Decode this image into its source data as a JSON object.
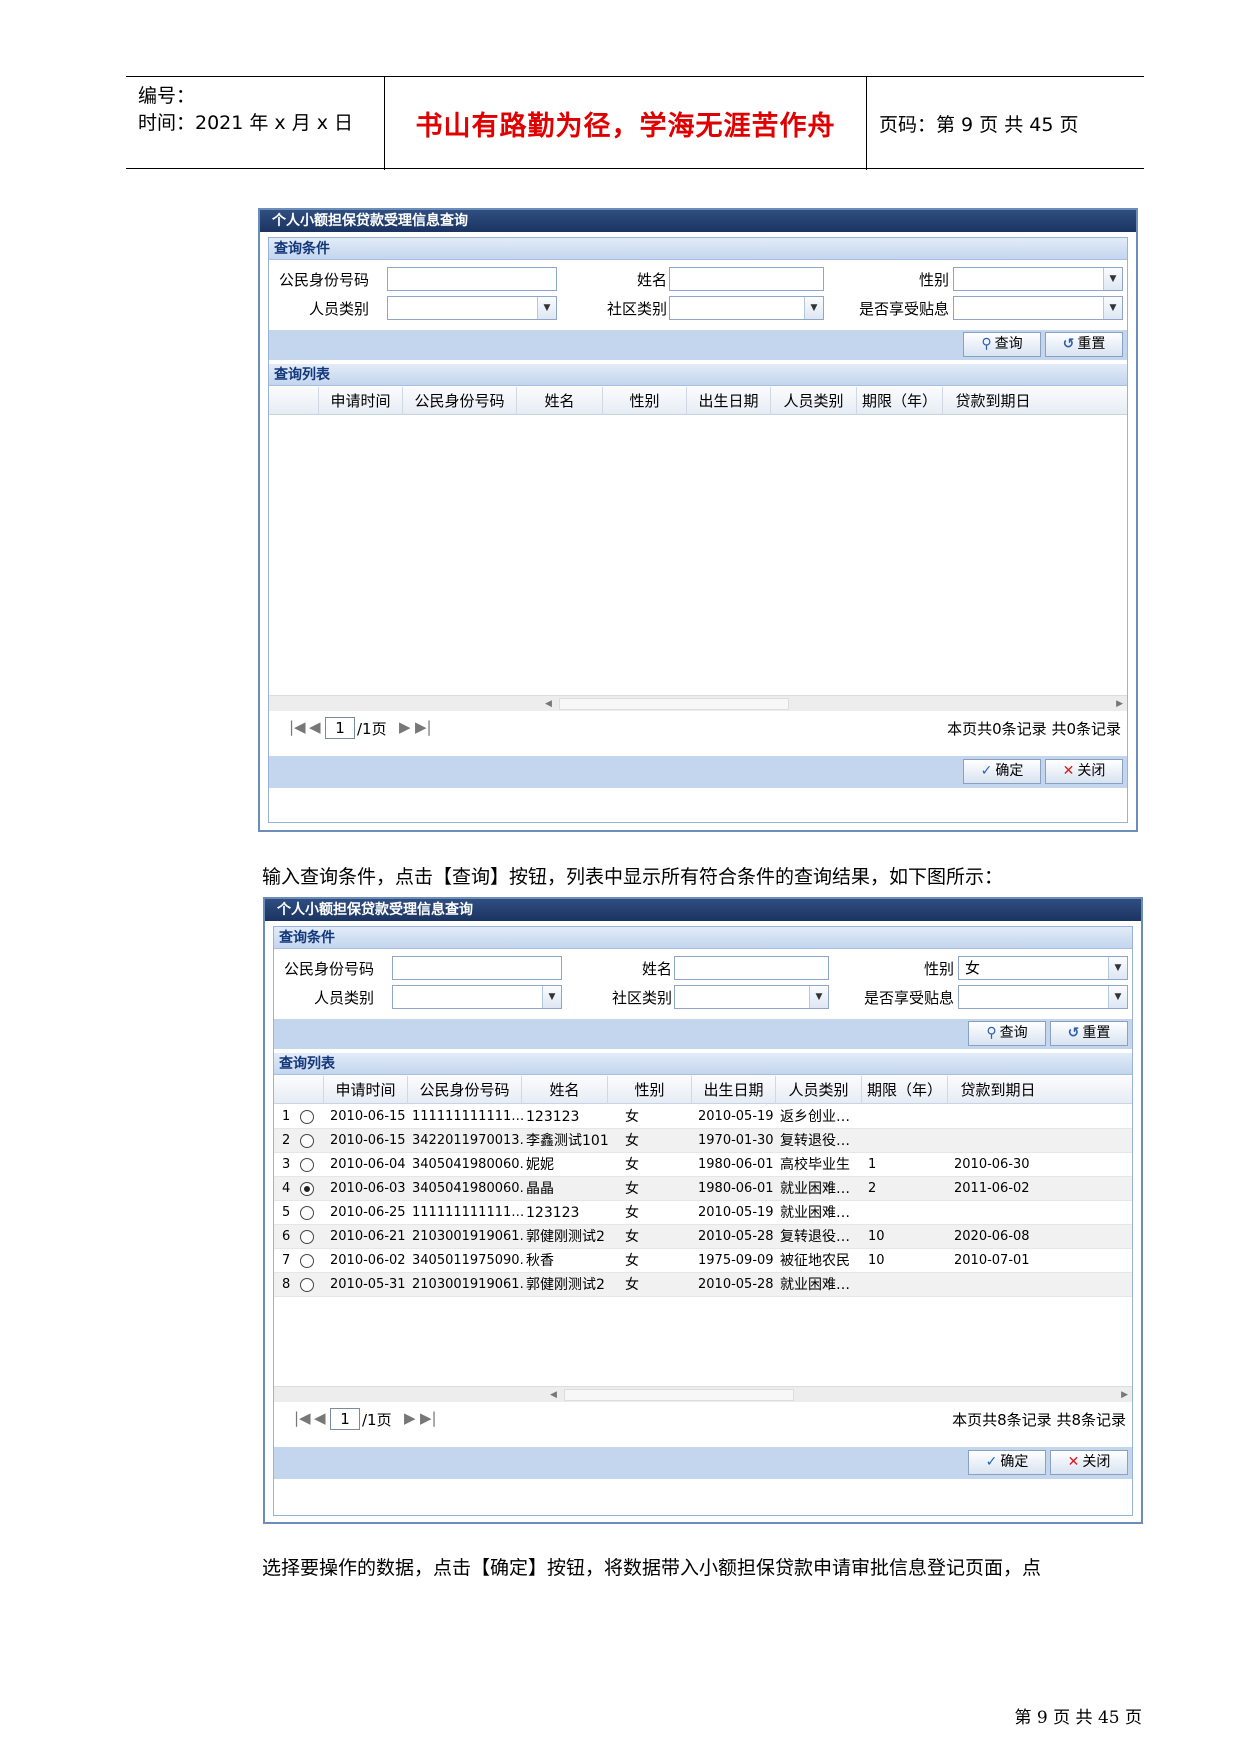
{
  "header": {
    "number_label": "编号：",
    "time_label": "时间：2021 年 x 月 x 日",
    "motto": "书山有路勤为径，学海无涯苦作舟",
    "page_label": "页码：第 9 页  共 45 页"
  },
  "window1": {
    "title": "个人小额担保贷款受理信息查询",
    "conditions_title": "查询条件",
    "labels": {
      "id": "公民身份号码",
      "name": "姓名",
      "gender": "性别",
      "person_type": "人员类别",
      "community": "社区类别",
      "subsidy": "是否享受贴息"
    },
    "values": {
      "id": "",
      "name": "",
      "gender": "",
      "person_type": "",
      "community": "",
      "subsidy": ""
    },
    "query_btn": "查询",
    "reset_btn": "重置",
    "list_title": "查询列表",
    "columns": [
      "申请时间",
      "公民身份号码",
      "姓名",
      "性别",
      "出生日期",
      "人员类别",
      "期限（年）",
      "贷款到期日"
    ],
    "pager": {
      "page": "1",
      "total_pages": "/1页",
      "summary": "本页共0条记录 共0条记录"
    },
    "ok_btn": "确定",
    "close_btn": "关闭"
  },
  "paragraph1": "输入查询条件，点击【查询】按钮，列表中显示所有符合条件的查询结果，如下图所示：",
  "window2": {
    "title": "个人小额担保贷款受理信息查询",
    "conditions_title": "查询条件",
    "labels": {
      "id": "公民身份号码",
      "name": "姓名",
      "gender": "性别",
      "person_type": "人员类别",
      "community": "社区类别",
      "subsidy": "是否享受贴息"
    },
    "values": {
      "id": "",
      "name": "",
      "gender": "女",
      "person_type": "",
      "community": "",
      "subsidy": ""
    },
    "query_btn": "查询",
    "reset_btn": "重置",
    "list_title": "查询列表",
    "columns": [
      "申请时间",
      "公民身份号码",
      "姓名",
      "性别",
      "出生日期",
      "人员类别",
      "期限（年）",
      "贷款到期日"
    ],
    "rows": [
      {
        "n": "1",
        "date": "2010-06-15",
        "id": "111111111111…",
        "name": "123123",
        "gender": "女",
        "birth": "2010-05-19",
        "type": "返乡创业…",
        "term": "",
        "due": "",
        "selected": false
      },
      {
        "n": "2",
        "date": "2010-06-15",
        "id": "3422011970013…",
        "name": "李鑫测试101",
        "gender": "女",
        "birth": "1970-01-30",
        "type": "复转退役…",
        "term": "",
        "due": "",
        "selected": false
      },
      {
        "n": "3",
        "date": "2010-06-04",
        "id": "3405041980060…",
        "name": "妮妮",
        "gender": "女",
        "birth": "1980-06-01",
        "type": "高校毕业生",
        "term": "1",
        "due": "2010-06-30",
        "selected": false
      },
      {
        "n": "4",
        "date": "2010-06-03",
        "id": "3405041980060…",
        "name": "晶晶",
        "gender": "女",
        "birth": "1980-06-01",
        "type": "就业困难…",
        "term": "2",
        "due": "2011-06-02",
        "selected": true
      },
      {
        "n": "5",
        "date": "2010-06-25",
        "id": "111111111111…",
        "name": "123123",
        "gender": "女",
        "birth": "2010-05-19",
        "type": "就业困难…",
        "term": "",
        "due": "",
        "selected": false
      },
      {
        "n": "6",
        "date": "2010-06-21",
        "id": "2103001919061…",
        "name": "郭健刚测试2",
        "gender": "女",
        "birth": "2010-05-28",
        "type": "复转退役…",
        "term": "10",
        "due": "2020-06-08",
        "selected": false
      },
      {
        "n": "7",
        "date": "2010-06-02",
        "id": "3405011975090…",
        "name": "秋香",
        "gender": "女",
        "birth": "1975-09-09",
        "type": "被征地农民",
        "term": "10",
        "due": "2010-07-01",
        "selected": false
      },
      {
        "n": "8",
        "date": "2010-05-31",
        "id": "2103001919061…",
        "name": "郭健刚测试2",
        "gender": "女",
        "birth": "2010-05-28",
        "type": "就业困难…",
        "term": "",
        "due": "",
        "selected": false
      }
    ],
    "pager": {
      "page": "1",
      "total_pages": "/1页",
      "summary": "本页共8条记录 共8条记录"
    },
    "ok_btn": "确定",
    "close_btn": "关闭"
  },
  "paragraph2": "选择要操作的数据，点击【确定】按钮，将数据带入小额担保贷款申请审批信息登记页面，点",
  "footer": "第 9 页 共 45 页"
}
